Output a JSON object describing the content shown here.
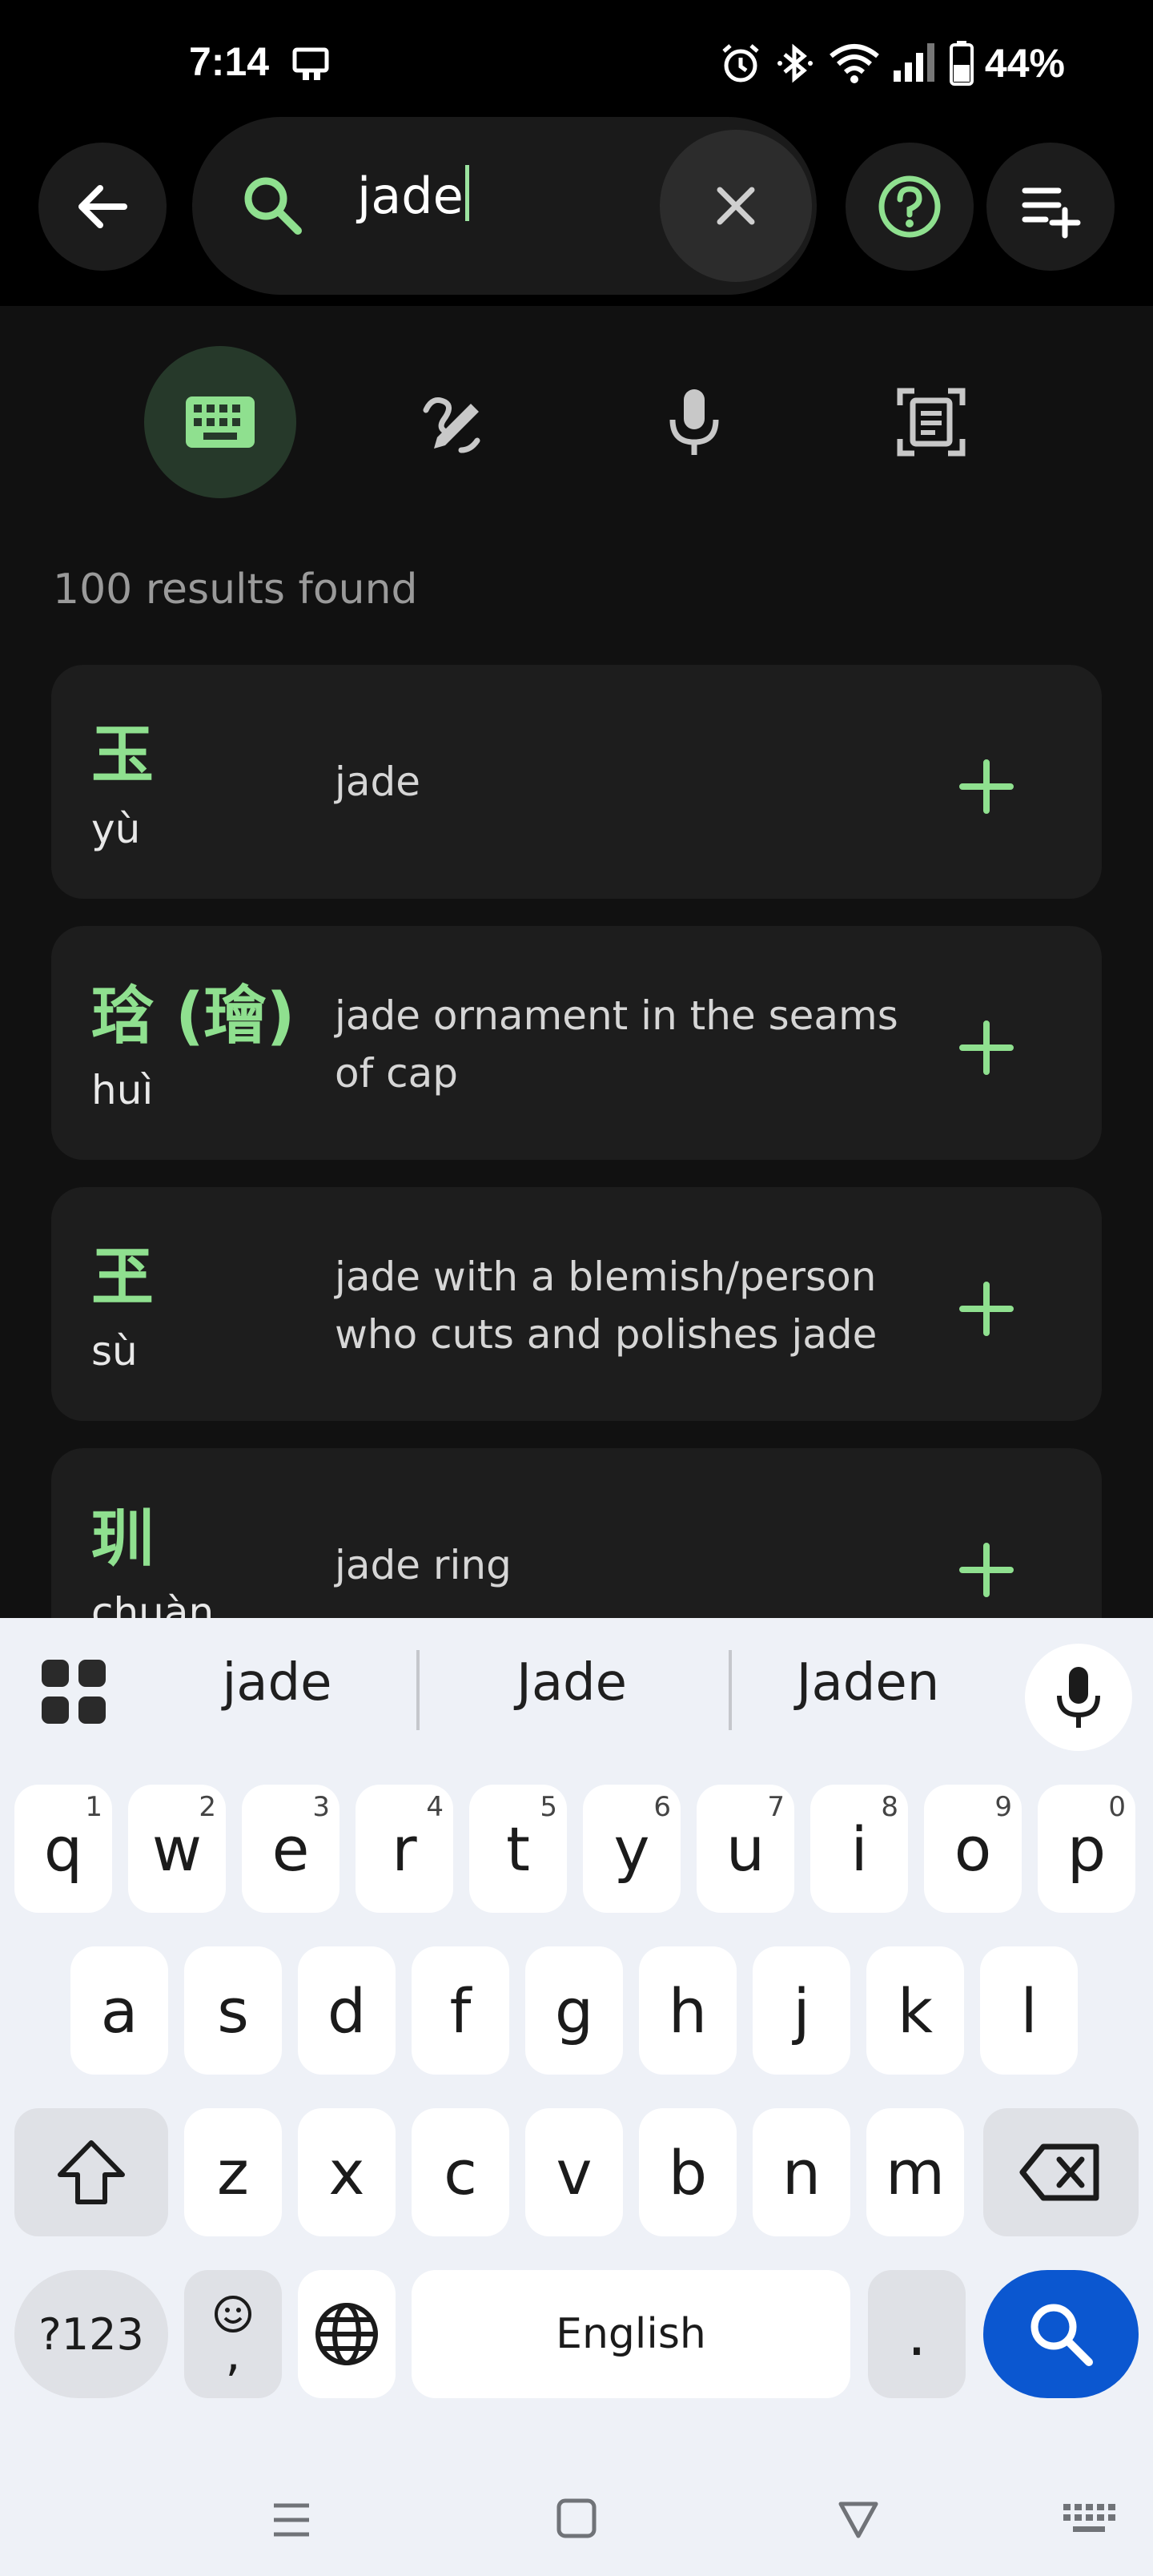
{
  "status_bar": {
    "time": "7:14",
    "battery": "44%"
  },
  "search": {
    "query": "jade"
  },
  "results": {
    "count_text": "100 results found",
    "items": [
      {
        "hanzi": "玉",
        "pinyin": "yù",
        "definition": "jade"
      },
      {
        "hanzi": "琀 (璯)",
        "pinyin": "huì",
        "definition": "jade ornament in the seams of cap"
      },
      {
        "hanzi": "玊",
        "pinyin": "sù",
        "definition": "jade with a blemish/person who cuts and polishes jade"
      },
      {
        "hanzi": "玔",
        "pinyin": "chuàn",
        "definition": "jade ring"
      }
    ]
  },
  "keyboard": {
    "suggestions": [
      "jade",
      "Jade",
      "Jaden"
    ],
    "row1": [
      {
        "k": "q",
        "h": "1"
      },
      {
        "k": "w",
        "h": "2"
      },
      {
        "k": "e",
        "h": "3"
      },
      {
        "k": "r",
        "h": "4"
      },
      {
        "k": "t",
        "h": "5"
      },
      {
        "k": "y",
        "h": "6"
      },
      {
        "k": "u",
        "h": "7"
      },
      {
        "k": "i",
        "h": "8"
      },
      {
        "k": "o",
        "h": "9"
      },
      {
        "k": "p",
        "h": "0"
      }
    ],
    "row2": [
      "a",
      "s",
      "d",
      "f",
      "g",
      "h",
      "j",
      "k",
      "l"
    ],
    "row3": [
      "z",
      "x",
      "c",
      "v",
      "b",
      "n",
      "m"
    ],
    "symbols_label": "?123",
    "emoji_comma": ",",
    "space_label": "English",
    "period": "."
  },
  "colors": {
    "accent": "#8fe08f",
    "card_bg": "#1d1d1d",
    "search_key": "#0b57d0"
  }
}
